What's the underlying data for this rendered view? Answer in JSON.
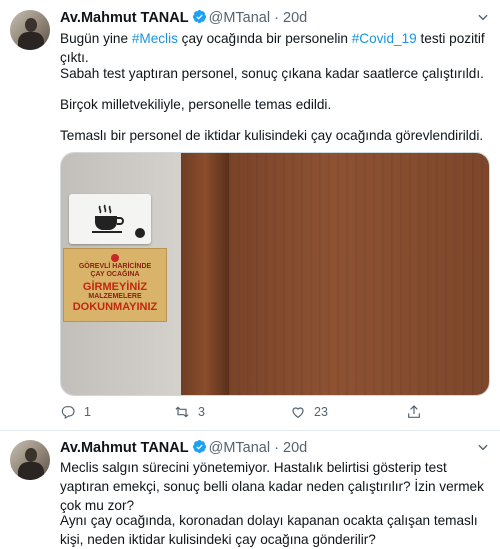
{
  "tweets": [
    {
      "author_name": "Av.Mahmut TANAL",
      "handle": "@MTanal",
      "separator": "·",
      "time": "20d",
      "paragraphs": [
        {
          "parts": [
            {
              "text": "Bugün yine ",
              "hl": false
            },
            {
              "text": "#Meclis",
              "hl": true
            },
            {
              "text": " çay ocağında bir personelin ",
              "hl": false
            },
            {
              "text": "#Covid_19",
              "hl": true
            },
            {
              "text": " testi pozitif çıktı.",
              "hl": false
            }
          ]
        },
        {
          "parts": [
            {
              "text": "Sabah test yaptıran personel, sonuç çıkana kadar saatlerce çalıştırıldı.",
              "hl": false
            }
          ]
        },
        {
          "parts": [
            {
              "text": "Birçok milletvekiliyle, personelle temas edildi.",
              "hl": false
            }
          ]
        },
        {
          "parts": [
            {
              "text": "Temaslı bir personel de iktidar kulisindeki çay ocağında görevlendirildi.",
              "hl": false
            }
          ]
        }
      ],
      "media": {
        "sign_lines": [
          "GÖREVLİ HARİCİNDE",
          "ÇAY OCAĞINA",
          "GİRMEYİNİZ",
          "MALZEMELERE",
          "DOKUNMAYINIZ"
        ]
      },
      "actions": {
        "replies": "1",
        "retweets": "3",
        "likes": "23"
      }
    },
    {
      "author_name": "Av.Mahmut TANAL",
      "handle": "@MTanal",
      "separator": "·",
      "time": "20d",
      "paragraphs": [
        {
          "parts": [
            {
              "text": "Meclis salgın sürecini yönetemiyor. Hastalık belirtisi gösterip test yaptıran emekçi, sonuç belli olana kadar neden çalıştırılır? İzin vermek çok mu zor?",
              "hl": false
            }
          ]
        },
        {
          "parts": [
            {
              "text": "Aynı çay ocağında, koronadan dolayı kapanan ocakta çalışan temaslı kişi, neden iktidar kulisindeki çay ocağına gönderilir?",
              "hl": false
            }
          ]
        }
      ]
    }
  ],
  "colors": {
    "link": "#1b95e0",
    "verified": "#1da1f2",
    "muted": "#536471"
  },
  "icons": [
    "verified-badge-icon",
    "chevron-down-icon",
    "reply-icon",
    "retweet-icon",
    "like-icon",
    "share-icon"
  ]
}
